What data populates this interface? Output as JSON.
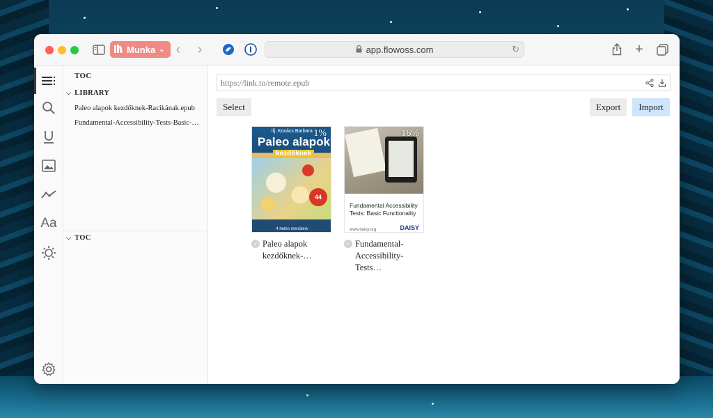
{
  "browser": {
    "tab_group": "Munka",
    "address": "app.flowoss.com"
  },
  "toc_panel": {
    "header": "TOC",
    "library_header": "LIBRARY",
    "library_items": [
      "Paleo alapok kezdőknek-Racikának.epub",
      "Fundamental-Accessibility-Tests-Basic-Functionality.epub"
    ],
    "toc_header": "TOC"
  },
  "main": {
    "url_placeholder": "https://link.to/remote.epub",
    "select_label": "Select",
    "export_label": "Export",
    "import_label": "Import"
  },
  "books": [
    {
      "percent": "1%",
      "title": "Paleo alapok kezdőknek-…",
      "cover_author": "ifj. Kovács Barbara",
      "cover_title": "Paleo alapok",
      "cover_subtitle": "kezdőknek",
      "cover_badge": "44",
      "cover_footer": "4 hetes menüterv"
    },
    {
      "percent": "16%",
      "title": "Fundamental-Accessibility-Tests…",
      "cover_text": "Fundamental Accessibility Tests: Basic Functionality",
      "cover_url": "www.daisy.org",
      "cover_logo": "DAISY"
    }
  ],
  "icons": {
    "sidebar": [
      "toc-icon",
      "search-icon",
      "underline-icon",
      "image-icon",
      "timeline-icon",
      "typography-icon",
      "theme-icon",
      "settings-icon"
    ]
  }
}
